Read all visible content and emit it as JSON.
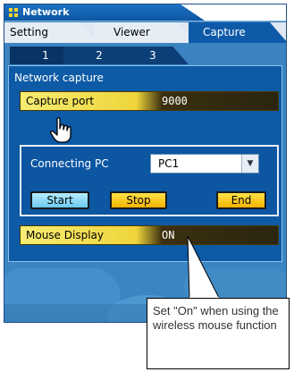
{
  "window": {
    "title": "Network"
  },
  "tabs": [
    {
      "label": "Setting"
    },
    {
      "label": "Viewer"
    },
    {
      "label": "Capture"
    }
  ],
  "subtabs": [
    {
      "label": "1"
    },
    {
      "label": "2"
    },
    {
      "label": "3"
    }
  ],
  "section": {
    "title": "Network capture"
  },
  "capture_port": {
    "label": "Capture port",
    "value": "9000"
  },
  "connecting_pc": {
    "label": "Connecting PC",
    "selected": "PC1"
  },
  "buttons": {
    "start": "Start",
    "stop": "Stop",
    "end": "End"
  },
  "mouse_display": {
    "label": "Mouse Display",
    "value": "ON"
  },
  "callout": {
    "text": "Set \"On\" when using the wireless mouse function"
  },
  "colors": {
    "panel": "#3a86c3",
    "active_tab": "#0f5aa8",
    "field_yellow": "#efd53c",
    "start_button": "#6ccbf0"
  }
}
